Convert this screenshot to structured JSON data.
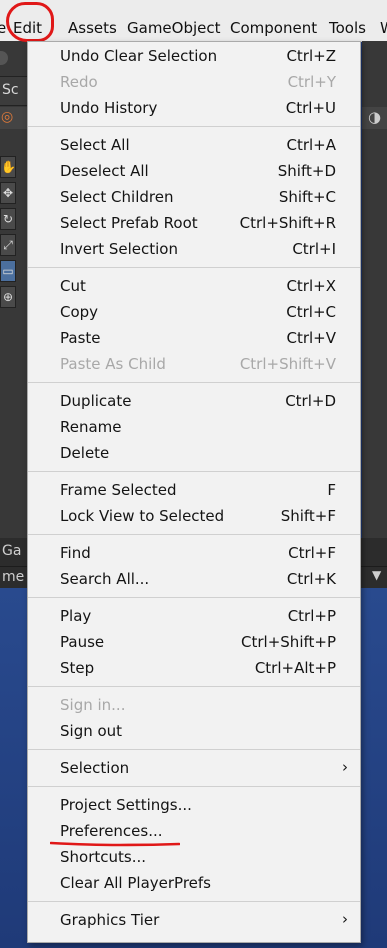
{
  "menubar": {
    "items": [
      {
        "label": "e"
      },
      {
        "label": "Edit"
      },
      {
        "label": "Assets"
      },
      {
        "label": "GameObject"
      },
      {
        "label": "Component"
      },
      {
        "label": "Tools"
      },
      {
        "label": "W"
      }
    ]
  },
  "background": {
    "left_tab_fragment": "Sc",
    "strip_fragment_top": "Ga",
    "strip_fragment_bottom": "me",
    "left_tools": [
      "hand-icon",
      "move-icon",
      "rotate-icon",
      "scale-icon",
      "rect-icon",
      "transform-icon"
    ]
  },
  "menu": {
    "items": [
      {
        "label": "Undo Clear Selection",
        "shortcut": "Ctrl+Z",
        "enabled": true
      },
      {
        "label": "Redo",
        "shortcut": "Ctrl+Y",
        "enabled": false
      },
      {
        "label": "Undo History",
        "shortcut": "Ctrl+U",
        "enabled": true
      },
      {
        "label": "Select All",
        "shortcut": "Ctrl+A",
        "enabled": true
      },
      {
        "label": "Deselect All",
        "shortcut": "Shift+D",
        "enabled": true
      },
      {
        "label": "Select Children",
        "shortcut": "Shift+C",
        "enabled": true
      },
      {
        "label": "Select Prefab Root",
        "shortcut": "Ctrl+Shift+R",
        "enabled": true
      },
      {
        "label": "Invert Selection",
        "shortcut": "Ctrl+I",
        "enabled": true
      },
      {
        "label": "Cut",
        "shortcut": "Ctrl+X",
        "enabled": true
      },
      {
        "label": "Copy",
        "shortcut": "Ctrl+C",
        "enabled": true
      },
      {
        "label": "Paste",
        "shortcut": "Ctrl+V",
        "enabled": true
      },
      {
        "label": "Paste As Child",
        "shortcut": "Ctrl+Shift+V",
        "enabled": false
      },
      {
        "label": "Duplicate",
        "shortcut": "Ctrl+D",
        "enabled": true
      },
      {
        "label": "Rename",
        "shortcut": "",
        "enabled": true
      },
      {
        "label": "Delete",
        "shortcut": "",
        "enabled": true
      },
      {
        "label": "Frame Selected",
        "shortcut": "F",
        "enabled": true
      },
      {
        "label": "Lock View to Selected",
        "shortcut": "Shift+F",
        "enabled": true
      },
      {
        "label": "Find",
        "shortcut": "Ctrl+F",
        "enabled": true
      },
      {
        "label": "Search All...",
        "shortcut": "Ctrl+K",
        "enabled": true
      },
      {
        "label": "Play",
        "shortcut": "Ctrl+P",
        "enabled": true
      },
      {
        "label": "Pause",
        "shortcut": "Ctrl+Shift+P",
        "enabled": true
      },
      {
        "label": "Step",
        "shortcut": "Ctrl+Alt+P",
        "enabled": true
      },
      {
        "label": "Sign in...",
        "shortcut": "",
        "enabled": false
      },
      {
        "label": "Sign out",
        "shortcut": "",
        "enabled": true
      },
      {
        "label": "Selection",
        "shortcut": "",
        "enabled": true,
        "submenu": true
      },
      {
        "label": "Project Settings...",
        "shortcut": "",
        "enabled": true
      },
      {
        "label": "Preferences...",
        "shortcut": "",
        "enabled": true,
        "highlighted_by_annotation": true
      },
      {
        "label": "Shortcuts...",
        "shortcut": "",
        "enabled": true
      },
      {
        "label": "Clear All PlayerPrefs",
        "shortcut": "",
        "enabled": true
      },
      {
        "label": "Graphics Tier",
        "shortcut": "",
        "enabled": true,
        "submenu": true
      }
    ],
    "submenu_arrow": "›"
  },
  "annotations": {
    "circle_color": "#e01818",
    "underline_color": "#e01818"
  },
  "colors": {
    "menu_bg": "#f2f2f2",
    "disabled_text": "#a8a8a8",
    "editor_dark": "#383838",
    "scene_blue": "#1f3a78"
  }
}
